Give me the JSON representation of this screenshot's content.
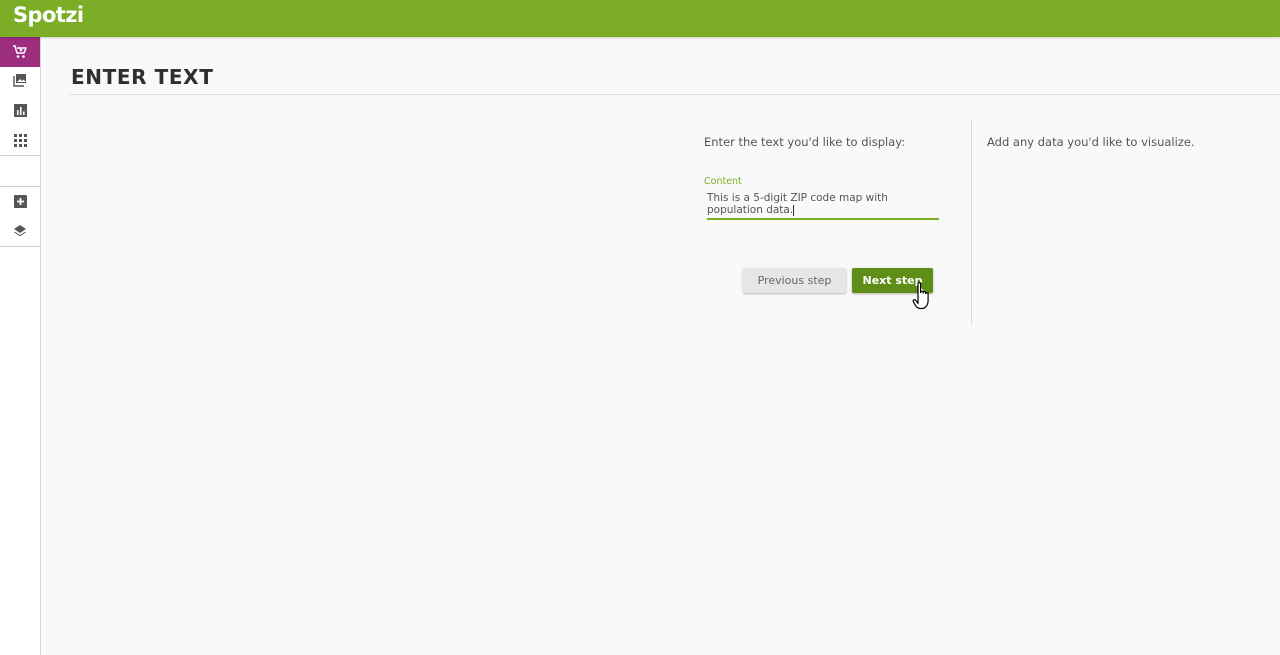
{
  "app": {
    "logo_text": "Spotzi",
    "brand_color": "#7bad26",
    "active_color": "#9c2d7f",
    "button_color": "#5e8d18"
  },
  "sidebar": {
    "items": [
      {
        "icon": "cart-icon",
        "active": true
      },
      {
        "icon": "image-icon",
        "active": false
      },
      {
        "icon": "bar-chart-icon",
        "active": false
      },
      {
        "icon": "grid-icon",
        "active": false
      },
      {
        "icon": "add-box-icon",
        "active": false
      },
      {
        "icon": "layers-icon",
        "active": false
      }
    ]
  },
  "page": {
    "title": "ENTER TEXT"
  },
  "form": {
    "prompt": "Enter the text you'd like to display:",
    "field_label": "Content",
    "content_value": "This is a 5-digit ZIP code map with population data.",
    "prev_label": "Previous step",
    "next_label": "Next step"
  },
  "help": {
    "text": "Add any data you'd like to visualize."
  }
}
